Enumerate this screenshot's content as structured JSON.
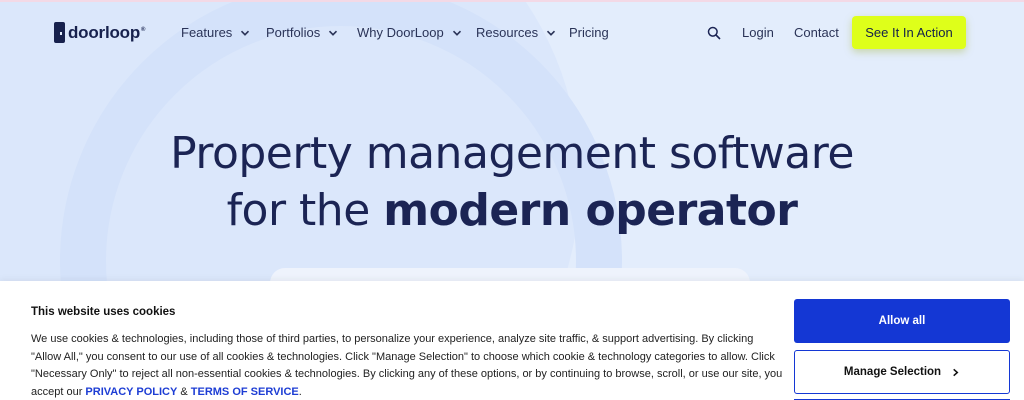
{
  "colors": {
    "accent": "#deff1a",
    "brand_dark": "#17214d",
    "primary_blue": "#1437d4",
    "hero_bg": "#e3edfc"
  },
  "nav": {
    "logo_text": "doorloop",
    "logo_reg": "®",
    "items": [
      {
        "label": "Features",
        "dropdown": true
      },
      {
        "label": "Portfolios",
        "dropdown": true
      },
      {
        "label": "Why DoorLoop",
        "dropdown": true
      },
      {
        "label": "Resources",
        "dropdown": true
      },
      {
        "label": "Pricing",
        "dropdown": false
      }
    ],
    "search_icon": "search-icon",
    "login_label": "Login",
    "contact_label": "Contact",
    "cta_label": "See It In Action"
  },
  "hero": {
    "line1": "Property management software",
    "line2_prefix": "for the ",
    "line2_bold": "modern operator"
  },
  "cookie": {
    "title": "This website uses cookies",
    "text": "We use cookies & technologies, including those of third parties, to personalize your experience, analyze site traffic, & support advertising. By clicking \"Allow All,\" you consent to our use of all cookies & technologies. Click \"Manage Selection\" to choose which cookie & technology categories to allow. Click \"Necessary Only\" to reject all non-essential cookies & technologies. By clicking any of these options, or by continuing to browse, scroll, or use our site, you accept our ",
    "privacy_link": "PRIVACY POLICY",
    "amp": " & ",
    "terms_link": "TERMS OF SERVICE",
    "end": ".",
    "allow_all_label": "Allow all",
    "manage_label": "Manage Selection"
  }
}
